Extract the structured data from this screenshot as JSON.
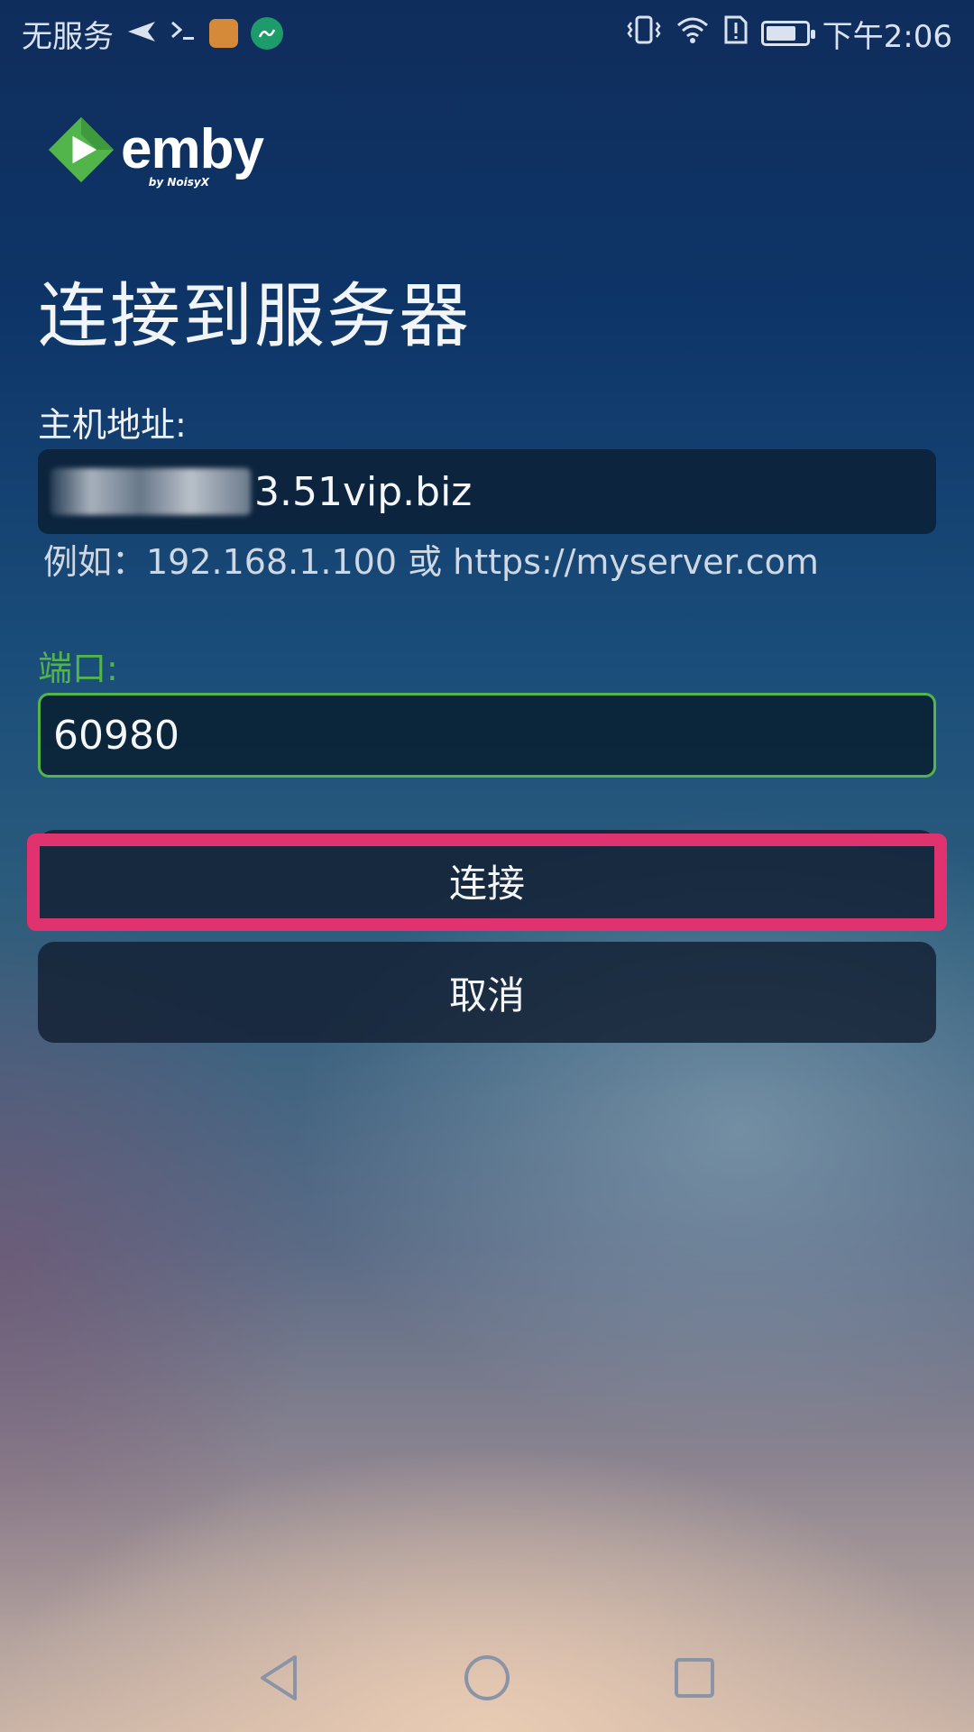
{
  "status_bar": {
    "carrier": "无服务",
    "time": "下午2:06",
    "left_icons": [
      "send-icon",
      "terminal-icon",
      "app-icon",
      "app-icon-2"
    ],
    "right_icons": [
      "vibrate-icon",
      "wifi-icon",
      "sim-alert-icon",
      "battery-icon"
    ]
  },
  "logo": {
    "word": "emby",
    "sub": "by NoisyX",
    "colors": {
      "mark_green": "#52b54b",
      "mark_dark": "#2f8a3a"
    }
  },
  "page": {
    "title": "连接到服务器"
  },
  "host": {
    "label": "主机地址:",
    "value_visible": "3.51vip.biz",
    "hint": "例如：192.168.1.100 或 https://myserver.com"
  },
  "port": {
    "label": "端口:",
    "value": "60980"
  },
  "buttons": {
    "connect": "连接",
    "cancel": "取消"
  },
  "accent": {
    "focus_green": "#52b54b",
    "highlight_pink": "#e0326f"
  },
  "nav": {
    "icons": [
      "back-icon",
      "home-icon",
      "recents-icon"
    ]
  }
}
